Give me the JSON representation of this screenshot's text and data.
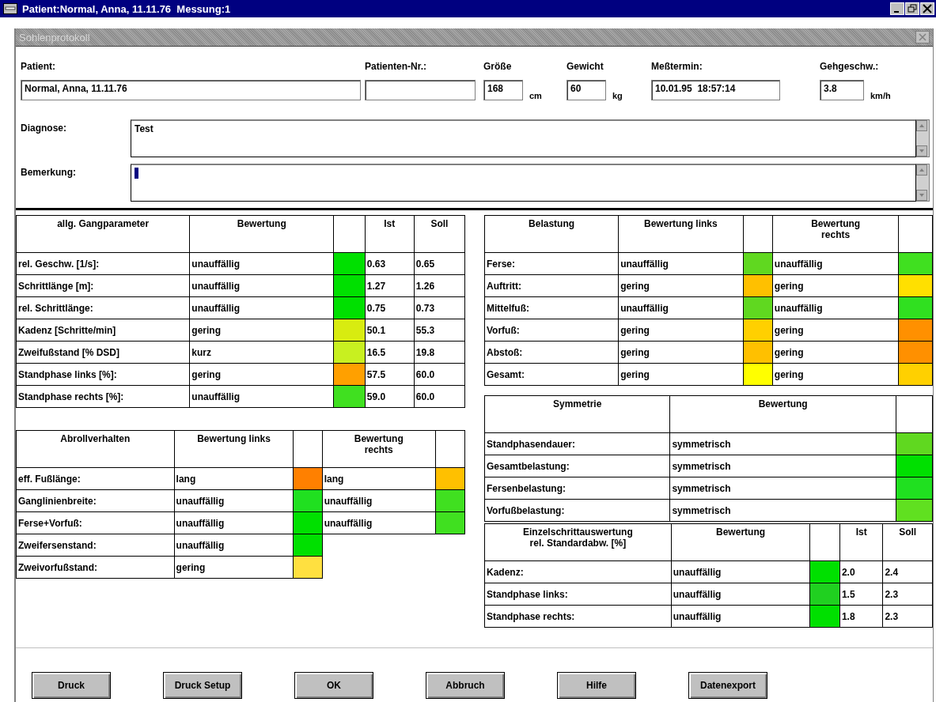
{
  "window": {
    "title": "Patient:Normal, Anna, 11.11.76  Messung:1"
  },
  "dialog": {
    "title": "Sohlenprotokoll"
  },
  "fields": [
    {
      "label": "Patient:",
      "value": "Normal, Anna, 11.11.76"
    },
    {
      "label": "Patienten-Nr.:"
    },
    {
      "label": "Größe",
      "value": "168",
      "unit": "cm"
    },
    {
      "label": "Gewicht",
      "value": "60",
      "unit": "kg"
    },
    {
      "label": "Meßtermin:",
      "value": "10.01.95  18:57:14"
    },
    {
      "label": "Gehgeschw.:",
      "value": "3.8",
      "unit": "km/h"
    }
  ],
  "notes": [
    {
      "label": "Diagnose:",
      "value": "Test",
      "focused": false
    },
    {
      "label": "Bemerkung:",
      "focused": true
    }
  ],
  "tables": [
    {
      "columns": [
        {
          "title": "allg. Gangparameter",
          "kind": "text"
        },
        {
          "title": "Bewertung",
          "kind": "text"
        },
        {
          "kind": "status"
        },
        {
          "title": "Ist",
          "kind": "text"
        },
        {
          "title": "Soll",
          "kind": "text"
        }
      ],
      "rows": [
        {
          "cells": [
            "rel. Geschw. [1/s]:",
            "unauffällig",
            {
              "color": "#00e000"
            },
            "0.63",
            "0.65"
          ]
        },
        {
          "cells": [
            "Schrittlänge [m]:",
            "unauffällig",
            {
              "color": "#00e000"
            },
            "1.27",
            "1.26"
          ]
        },
        {
          "cells": [
            "rel. Schrittlänge:",
            "unauffällig",
            {
              "color": "#00e000"
            },
            "0.75",
            "0.73"
          ]
        },
        {
          "cells": [
            "Kadenz [Schritte/min]",
            "gering",
            {
              "color": "#d8ec10"
            },
            "50.1",
            "55.3"
          ]
        },
        {
          "cells": [
            "Zweifußstand [% DSD]",
            "kurz",
            {
              "color": "#c8f020"
            },
            "16.5",
            "19.8"
          ]
        },
        {
          "cells": [
            "Standphase links [%]:",
            "gering",
            {
              "color": "#ffa000"
            },
            "57.5",
            "60.0"
          ]
        },
        {
          "cells": [
            "Standphase rechts [%]:",
            "unauffällig",
            {
              "color": "#40e020"
            },
            "59.0",
            "60.0"
          ]
        }
      ]
    },
    {
      "columns": [
        {
          "title": "Abrollverhalten",
          "kind": "text"
        },
        {
          "title": "Bewertung links",
          "kind": "text"
        },
        {
          "kind": "status"
        },
        {
          "title": "Bewertung\nrechts",
          "kind": "text"
        },
        {
          "kind": "status"
        }
      ],
      "rows": [
        {
          "cells": [
            "eff. Fußlänge:",
            "lang",
            {
              "color": "#ff8000"
            },
            "lang",
            {
              "color": "#ffc000"
            }
          ]
        },
        {
          "cells": [
            "Ganglinienbreite:",
            "unauffällig",
            {
              "color": "#20e020"
            },
            "unauffällig",
            {
              "color": "#40e020"
            }
          ]
        },
        {
          "cells": [
            "Ferse+Vorfuß:",
            "unauffällig",
            {
              "color": "#00e000"
            },
            "unauffällig",
            {
              "color": "#40e020"
            }
          ]
        },
        {
          "cells": [
            "Zweifersenstand:",
            "unauffällig",
            {
              "color": "#00e000"
            }
          ]
        },
        {
          "cells": [
            "Zweivorfußstand:",
            "gering",
            {
              "color": "#ffe040"
            }
          ]
        }
      ]
    },
    {
      "columns": [
        {
          "title": "Belastung",
          "kind": "text"
        },
        {
          "title": "Bewertung links",
          "kind": "text"
        },
        {
          "kind": "status"
        },
        {
          "title": "Bewertung\nrechts",
          "kind": "text"
        },
        {
          "kind": "status"
        }
      ],
      "rows": [
        {
          "cells": [
            "Ferse:",
            "unauffällig",
            {
              "color": "#60d820"
            },
            "unauffällig",
            {
              "color": "#40e020"
            }
          ]
        },
        {
          "cells": [
            "Auftritt:",
            "gering",
            {
              "color": "#ffc000"
            },
            "gering",
            {
              "color": "#ffe000"
            }
          ]
        },
        {
          "cells": [
            "Mittelfuß:",
            "unauffällig",
            {
              "color": "#60d820"
            },
            "unauffällig",
            {
              "color": "#30e020"
            }
          ]
        },
        {
          "cells": [
            "Vorfuß:",
            "gering",
            {
              "color": "#ffd000"
            },
            "gering",
            {
              "color": "#ff9000"
            }
          ]
        },
        {
          "cells": [
            "Abstoß:",
            "gering",
            {
              "color": "#ffc000"
            },
            "gering",
            {
              "color": "#ff9000"
            }
          ]
        },
        {
          "cells": [
            "Gesamt:",
            "gering",
            {
              "color": "#ffff00"
            },
            "gering",
            {
              "color": "#ffd000"
            }
          ]
        }
      ]
    },
    {
      "columns": [
        {
          "title": "Symmetrie",
          "kind": "text"
        },
        {
          "title": "Bewertung",
          "kind": "text"
        },
        {
          "kind": "status"
        }
      ],
      "rows": [
        {
          "cells": [
            "Standphasendauer:",
            "symmetrisch",
            {
              "color": "#60d820"
            }
          ]
        },
        {
          "cells": [
            "Gesamtbelastung:",
            "symmetrisch",
            {
              "color": "#00e000"
            }
          ]
        },
        {
          "cells": [
            "Fersenbelastung:",
            "symmetrisch",
            {
              "color": "#20e020"
            }
          ]
        },
        {
          "cells": [
            "Vorfußbelastung:",
            "symmetrisch",
            {
              "color": "#60e020"
            }
          ]
        }
      ]
    },
    {
      "columns": [
        {
          "title": "Einzelschrittauswertung\nrel. Standardabw. [%]",
          "kind": "text"
        },
        {
          "title": "Bewertung",
          "kind": "text"
        },
        {
          "kind": "status"
        },
        {
          "title": "Ist",
          "kind": "text"
        },
        {
          "title": "Soll",
          "kind": "text"
        }
      ],
      "rows": [
        {
          "cells": [
            "Kadenz:",
            "unauffällig",
            {
              "color": "#00e000"
            },
            "2.0",
            "2.4"
          ]
        },
        {
          "cells": [
            "Standphase links:",
            "unauffällig",
            {
              "color": "#20d020"
            },
            "1.5",
            "2.3"
          ]
        },
        {
          "cells": [
            "Standphase rechts:",
            "unauffällig",
            {
              "color": "#00e000"
            },
            "1.8",
            "2.3"
          ]
        }
      ]
    }
  ],
  "buttons": [
    "Druck",
    "Druck Setup",
    "OK",
    "Abbruch",
    "Hilfe",
    "Datenexport"
  ]
}
